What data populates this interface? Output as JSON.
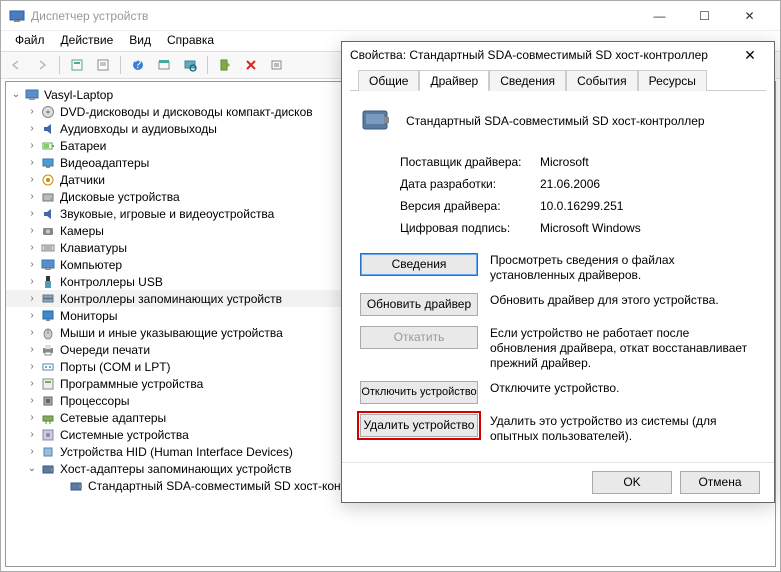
{
  "window": {
    "title": "Диспетчер устройств",
    "min": "—",
    "max": "☐",
    "close": "✕"
  },
  "menu": {
    "file": "Файл",
    "action": "Действие",
    "view": "Вид",
    "help": "Справка"
  },
  "tree": {
    "root": "Vasyl-Laptop",
    "items": [
      "DVD-дисководы и дисководы компакт-дисков",
      "Аудиовходы и аудиовыходы",
      "Батареи",
      "Видеоадаптеры",
      "Датчики",
      "Дисковые устройства",
      "Звуковые, игровые и видеоустройства",
      "Камеры",
      "Клавиатуры",
      "Компьютер",
      "Контроллеры USB",
      "Контроллеры запоминающих устройств",
      "Мониторы",
      "Мыши и иные указывающие устройства",
      "Очереди печати",
      "Порты (COM и LPT)",
      "Программные устройства",
      "Процессоры",
      "Сетевые адаптеры",
      "Системные устройства",
      "Устройства HID (Human Interface Devices)",
      "Хост-адаптеры запоминающих устройств"
    ],
    "child": "Стандартный SDA-совместимый SD хост-контроллер"
  },
  "dialog": {
    "title": "Свойства: Стандартный SDA-совместимый SD хост-контроллер",
    "tabs": {
      "general": "Общие",
      "driver": "Драйвер",
      "details": "Сведения",
      "events": "События",
      "resources": "Ресурсы"
    },
    "device_name": "Стандартный SDA-совместимый SD хост-контроллер",
    "rows": {
      "provider_lbl": "Поставщик драйвера:",
      "provider_val": "Microsoft",
      "date_lbl": "Дата разработки:",
      "date_val": "21.06.2006",
      "version_lbl": "Версия драйвера:",
      "version_val": "10.0.16299.251",
      "signer_lbl": "Цифровая подпись:",
      "signer_val": "Microsoft Windows"
    },
    "buttons": {
      "details": "Сведения",
      "details_desc": "Просмотреть сведения о файлах установленных драйверов.",
      "update": "Обновить драйвер",
      "update_desc": "Обновить драйвер для этого устройства.",
      "rollback": "Откатить",
      "rollback_desc": "Если устройство не работает после обновления драйвера, откат восстанавливает прежний драйвер.",
      "disable": "Отключить устройство",
      "disable_desc": "Отключите устройство.",
      "uninstall": "Удалить устройство",
      "uninstall_desc": "Удалить это устройство из системы (для опытных пользователей)."
    },
    "ok": "OK",
    "cancel": "Отмена"
  }
}
